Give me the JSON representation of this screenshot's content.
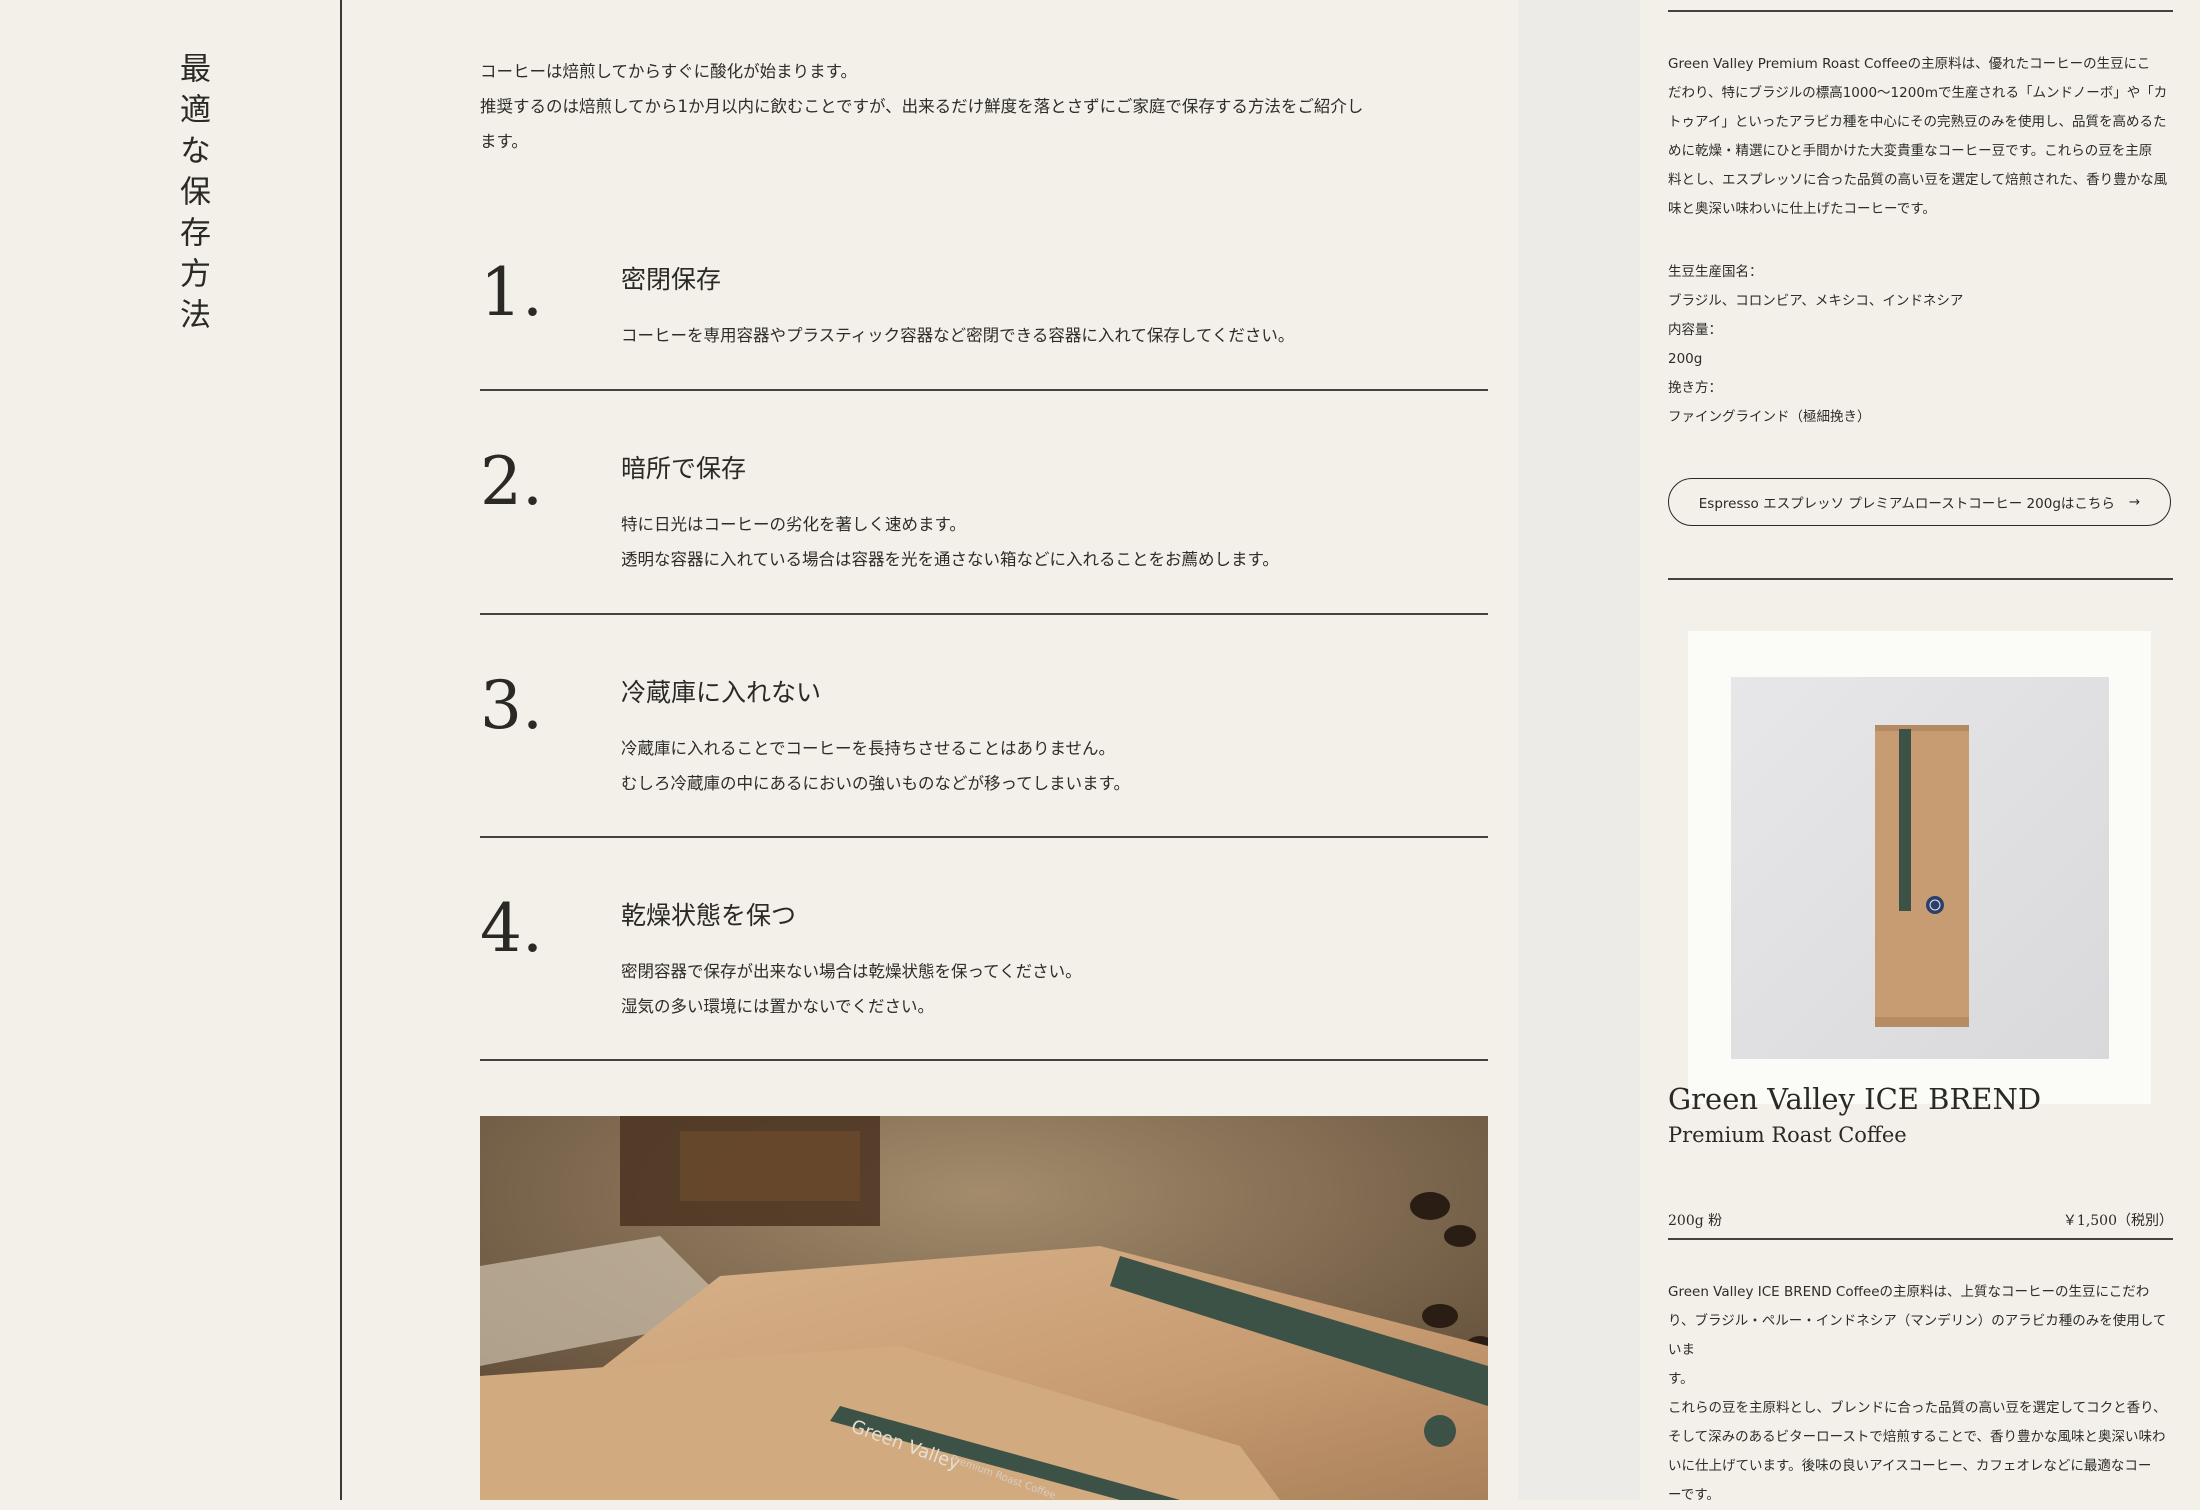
{
  "left": {
    "title": "最適な保存方法"
  },
  "intro": {
    "line1": "コーヒーは焙煎してからすぐに酸化が始まります。",
    "line2": "推奨するのは焙煎してから1か月以内に飲むことですが、出来るだけ鮮度を落とさずにご家庭で保存する方法をご紹介し",
    "line3": "ます。"
  },
  "steps": [
    {
      "number": "1.",
      "title": "密閉保存",
      "lines": [
        "コーヒーを専用容器やプラスティック容器など密閉できる容器に入れて保存してください。"
      ]
    },
    {
      "number": "2.",
      "title": "暗所で保存",
      "lines": [
        "特に日光はコーヒーの劣化を著しく速めます。",
        "透明な容器に入れている場合は容器を光を通さない箱などに入れることをお薦めします。"
      ]
    },
    {
      "number": "3.",
      "title": "冷蔵庫に入れない",
      "lines": [
        "冷蔵庫に入れることでコーヒーを長持ちさせることはありません。",
        "むしろ冷蔵庫の中にあるにおいの強いものなどが移ってしまいます。"
      ]
    },
    {
      "number": "4.",
      "title": "乾燥状態を保つ",
      "lines": [
        "密閉容器で保存が出来ない場合は乾燥状態を保ってください。",
        "湿気の多い環境には置かないでください。"
      ]
    }
  ],
  "photo": {
    "bag_label": "Green Valley",
    "bag_sublabel": "Premium Roast Coffee"
  },
  "side": {
    "desc1_lines": [
      "Green Valley Premium Roast Coffeeの主原料は、優れたコーヒーの生豆にこ",
      "だわり、特にブラジルの標高1000〜1200mで生産される「ムンドノーボ」や「カ",
      "トゥアイ」といったアラビカ種を中心にその完熟豆のみを使用し、品質を高めるた",
      "めに乾燥・精選にひと手間かけた大変貴重なコーヒー豆です。これらの豆を主原",
      "料とし、エスプレッソに合った品質の高い豆を選定して焙煎された、香り豊かな風",
      "味と奥深い味わいに仕上げたコーヒーです。"
    ],
    "specs": [
      "生豆生産国名：",
      "ブラジル、コロンビア、メキシコ、インドネシア",
      "内容量：",
      "200g",
      "挽き方：",
      "ファイングラインド（極細挽き）"
    ],
    "espresso_button": "Espresso エスプレッソ プレミアムローストコーヒー 200gはこちら",
    "arrow": "→",
    "product": {
      "name": "Green Valley ICE BREND",
      "subtitle": "Premium Roast Coffee",
      "size": "200g 粉",
      "price": "￥1,500（税別）"
    },
    "desc2_lines": [
      "Green Valley ICE BREND Coffeeの主原料は、上質なコーヒーの生豆にこだわ",
      "り、ブラジル・ペルー・インドネシア（マンデリン）のアラビカ種のみを使用していま",
      "す。",
      "これらの豆を主原料とし、ブレンドに合った品質の高い豆を選定してコクと香り、",
      "そして深みのあるビターローストで焙煎することで、香り豊かな風味と奥深い味わ",
      "いに仕上げています。後味の良いアイスコーヒー、カフェオレなどに最適なコー",
      "ーです。"
    ]
  },
  "colors": {
    "background": "#f3f0ea",
    "text": "#2b2925",
    "bag_green": "#3d5246",
    "kraft": "#c89c72"
  }
}
